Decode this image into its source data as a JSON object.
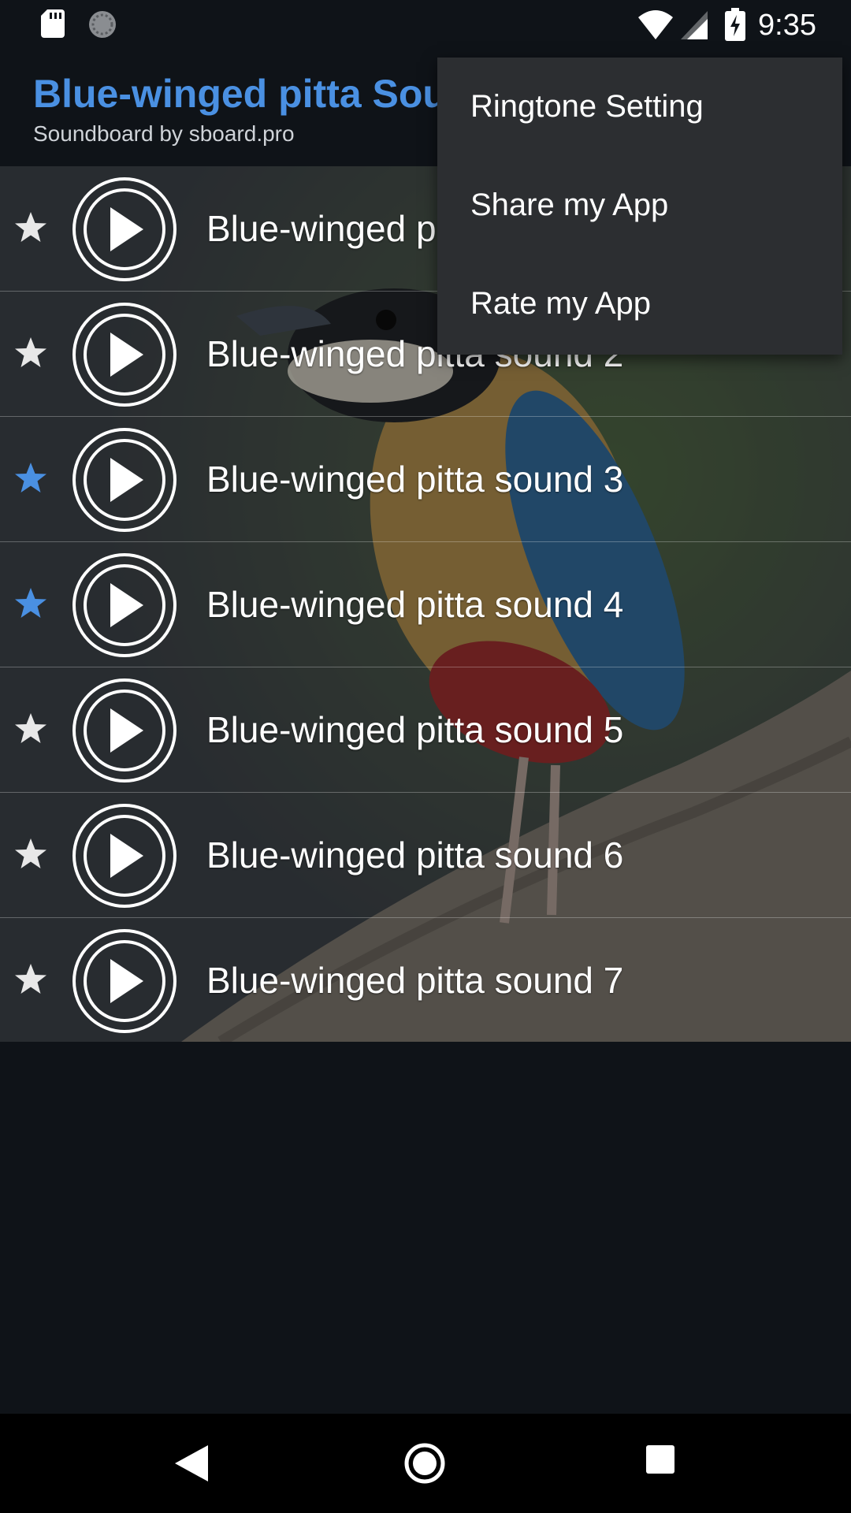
{
  "status_bar": {
    "time": "9:35",
    "icons": [
      "sd-card-icon",
      "sync-icon",
      "wifi-icon",
      "signal-icon",
      "battery-charging-icon"
    ]
  },
  "app_bar": {
    "title": "Blue-winged pitta Sou",
    "subtitle": "Soundboard by sboard.pro"
  },
  "sounds": [
    {
      "label": "Blue-winged p",
      "favorite": false
    },
    {
      "label": "Blue-winged pitta sound 2",
      "favorite": false
    },
    {
      "label": "Blue-winged pitta sound 3",
      "favorite": true
    },
    {
      "label": "Blue-winged pitta sound 4",
      "favorite": true
    },
    {
      "label": "Blue-winged pitta sound 5",
      "favorite": false
    },
    {
      "label": "Blue-winged pitta sound 6",
      "favorite": false
    },
    {
      "label": "Blue-winged pitta sound 7",
      "favorite": false
    }
  ],
  "menu": {
    "items": [
      "Ringtone Setting",
      "Share my App",
      "Rate my App"
    ]
  },
  "colors": {
    "accent": "#4a90e2",
    "star_active": "#4a90e2",
    "star_inactive": "#e8e8e8",
    "background": "#0f1318",
    "menu_background": "#2c2e31"
  },
  "nav_bar": {
    "icons": [
      "back-icon",
      "home-icon",
      "recents-icon"
    ]
  }
}
